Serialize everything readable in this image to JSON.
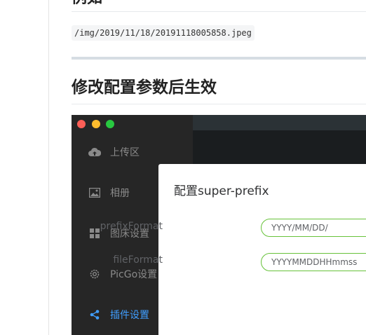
{
  "doc": {
    "prev_heading": "例如",
    "code_example": "/img/2019/11/18/20191118005858.jpeg",
    "section_heading": "修改配置参数后生效"
  },
  "app": {
    "sidebar": {
      "items": [
        {
          "label": "上传区",
          "icon": "cloud-upload-icon",
          "active": false
        },
        {
          "label": "相册",
          "icon": "image-icon",
          "active": false
        },
        {
          "label": "图床设置",
          "icon": "grid-icon",
          "active": false
        },
        {
          "label": "PicGo设置",
          "icon": "gear-icon",
          "active": false
        },
        {
          "label": "插件设置",
          "icon": "share-icon",
          "active": true
        }
      ]
    },
    "dialog": {
      "title": "配置super-prefix",
      "fields": [
        {
          "label": "prefixFormat",
          "value": "YYYY/MM/DD/"
        },
        {
          "label": "fileFormat",
          "value": "YYYYMMDDHHmmss"
        }
      ]
    }
  },
  "colors": {
    "accent": "#409eff",
    "input_border": "#67c23a",
    "traffic_red": "#fe5f57",
    "traffic_yellow": "#febc2e",
    "traffic_green": "#28c840"
  }
}
